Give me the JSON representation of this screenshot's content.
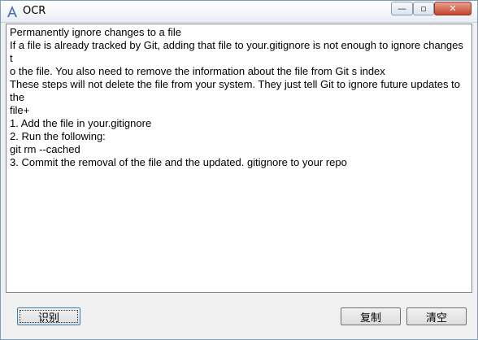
{
  "window": {
    "title": "OCR",
    "controls": {
      "minimize": "—",
      "maximize": "▫",
      "close": "✕"
    }
  },
  "text_area": {
    "lines": [
      "Permanently ignore changes to a file",
      "If a file is already tracked by Git, adding that file to your.gitignore is not enough to ignore changes",
      "t",
      "o the file. You also need to remove the information about the file from Git s index",
      " These steps will not delete the file from your system. They just tell Git to ignore future updates to",
      "the",
      " file+",
      " 1. Add the file in your.gitignore",
      " 2. Run the following:",
      " git rm --cached",
      " 3. Commit the removal of the file and the updated. gitignore to your repo"
    ]
  },
  "buttons": {
    "recognize": "识别",
    "copy": "复制",
    "clear": "清空"
  },
  "colors": {
    "window_border": "#7f9db9",
    "close_button": "#c7452c",
    "text_background": "#ffffff"
  },
  "icons": {
    "app": "ocr-app-icon"
  }
}
